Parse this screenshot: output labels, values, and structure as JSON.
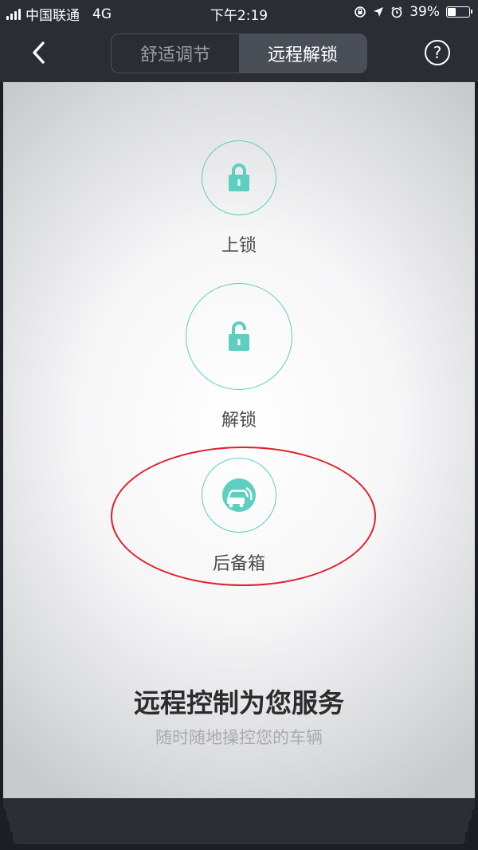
{
  "status_bar": {
    "carrier": "中国联通",
    "network": "4G",
    "time": "下午2:19",
    "battery_percent": "39%",
    "battery_level": 0.39
  },
  "nav": {
    "tabs": [
      {
        "label": "舒适调节",
        "active": false
      },
      {
        "label": "远程解锁",
        "active": true
      }
    ],
    "help_label": "?"
  },
  "controls": {
    "lock_label": "上锁",
    "unlock_label": "解锁",
    "trunk_label": "后备箱"
  },
  "promo": {
    "title": "远程控制为您服务",
    "subtitle": "随时随地操控您的车辆"
  },
  "colors": {
    "accent": "#5dcfc0",
    "highlight": "#e0202a",
    "bar": "#2a2d33"
  }
}
